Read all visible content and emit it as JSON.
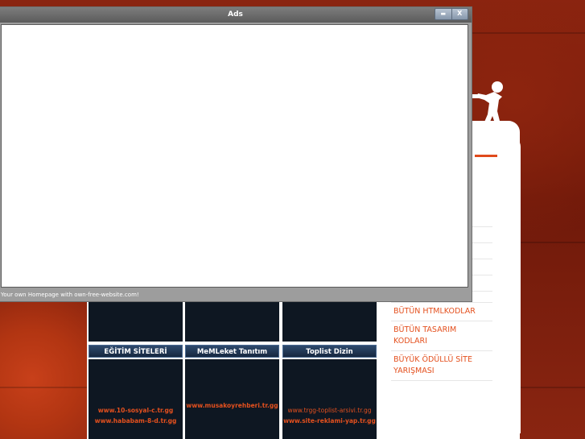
{
  "ads_window": {
    "title": "Ads",
    "minimize_label": "▬",
    "close_label": "X",
    "footer_text": "Your own Homepage with own-free-website.com!"
  },
  "sidebar": {
    "links": [
      {
        "label": "BÜTÜN HTMLKODLAR"
      },
      {
        "label": "BÜTÜN TASARIM KODLARI"
      },
      {
        "label": "BÜYÜK ÖDÜLLÜ SİTE YARIŞMASI"
      }
    ]
  },
  "boxes": [
    {
      "title": "EĞİTİM SİTELERİ",
      "links": [
        "www.10-sosyal-c.tr.gg",
        "www.hababam-8-d.tr.gg"
      ]
    },
    {
      "title": "MeMLeket Tanıtım",
      "links": [
        "www.musakoyrehberi.tr.gg"
      ]
    },
    {
      "title": "Toplist Dizin",
      "links": [
        "www.trgg-toplist-arsivi.tr.gg",
        "www.site-reklami-yap.tr.gg"
      ]
    }
  ],
  "colors": {
    "accent": "#e4501e",
    "background": "#7a1a0c",
    "box_background": "#0e1722",
    "box_header": "#1f3555"
  },
  "icons": [
    "mascot-figure-icon"
  ]
}
